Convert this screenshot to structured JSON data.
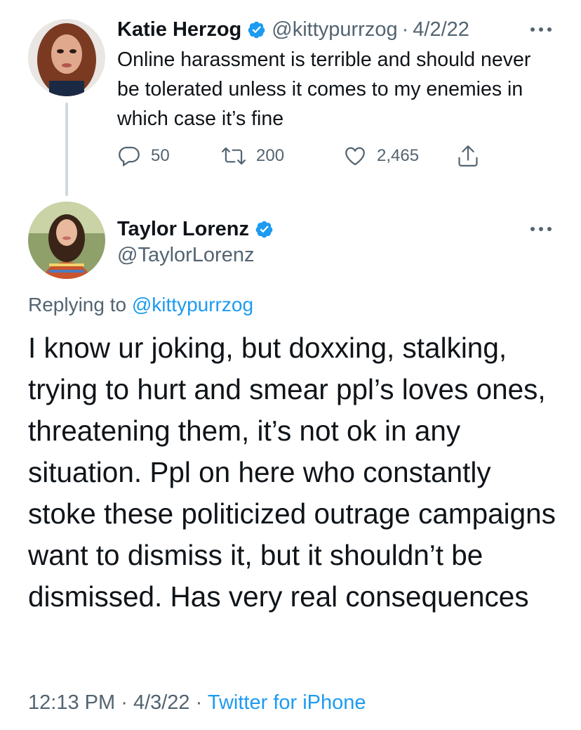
{
  "tweet1": {
    "author_name": "Katie Herzog",
    "handle": "@kittypurrzog",
    "separator": "·",
    "date": "4/2/22",
    "text": "Online harassment is terrible and should never be tolerated unless it comes to my enemies in which case it’s fine",
    "replies": "50",
    "retweets": "200",
    "likes": "2,465"
  },
  "tweet2": {
    "author_name": "Taylor Lorenz",
    "handle": "@TaylorLorenz",
    "replying_prefix": "Replying to",
    "replying_to": "@kittypurrzog",
    "text": "I know ur joking, but doxxing, stalking, trying to hurt and smear ppl’s loves ones, threatening them, it’s not ok in any situation. Ppl on here who constantly stoke these politicized outrage campaigns want to dismiss it, but it shouldn’t be dismissed. Has very real consequences",
    "time": "12:13 PM",
    "sep": "·",
    "date": "4/3/22",
    "source": "Twitter for iPhone"
  },
  "colors": {
    "text": "#0f1419",
    "muted": "#536471",
    "link": "#1d9bf0",
    "verified": "#1d9bf0",
    "thread_line": "#cfd9de"
  },
  "icons": [
    "verified-badge-icon",
    "more-options-icon",
    "reply-icon",
    "retweet-icon",
    "like-icon",
    "share-icon"
  ]
}
